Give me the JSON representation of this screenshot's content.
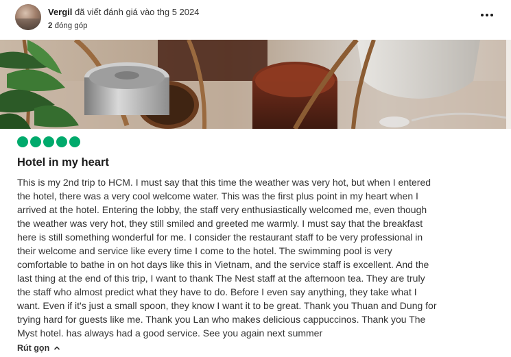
{
  "review": {
    "author": {
      "name": "Vergil",
      "action": "đã viết đánh giá vào thg 5 2024",
      "contributions": "2",
      "contributions_label": "đóng góp"
    },
    "more_icon": "more-horizontal-icon",
    "rating_bubbles": 5,
    "rating_color": "#00aa6c",
    "title": "Hotel in my heart",
    "body_lines": [
      "This is my 2nd trip to HCM. I must say that this time the weather was very hot, but when I entered",
      "the hotel, there was a very cool welcome water. This was the first plus point in my heart when I",
      "arrived at the hotel. Entering the lobby, the staff very enthusiastically welcomed me, even though",
      "the weather was very hot, they still smiled and greeted me warmly. I must say that the breakfast",
      "here is still something wonderful for me. I consider the restaurant staff to be very professional in",
      "their welcome and service like every time I come to the hotel. The swimming pool is very",
      "comfortable to bathe in on hot days like this in Vietnam, and the service staff is excellent. And the",
      "last thing at the end of this trip, I want to thank The Nest staff at the afternoon tea. They are truly",
      "the staff who almost predict what they have to do. Before I even say anything, they take what I",
      "want. Even if it's just a small spoon, they know I want it to be great. Thank you Thuan and Dung for",
      "trying hard for guests like me. Thank you Lan who makes delicious cappuccinos. Thank you The",
      "Myst hotel. has always had a good service. See you again next summer"
    ],
    "read_less_label": "Rút gọn",
    "read_less_icon": "chevron-up-icon"
  }
}
